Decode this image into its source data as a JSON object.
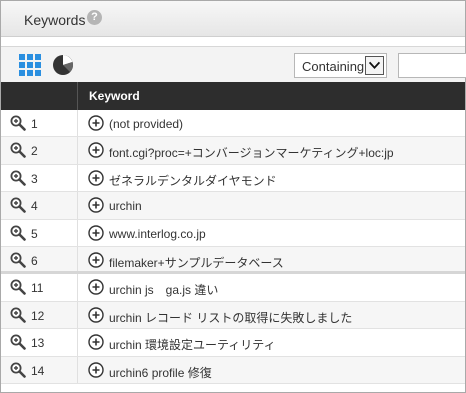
{
  "header": {
    "title": "Keywords",
    "help_icon": "?"
  },
  "toolbar": {
    "icons": [
      "grid-view-icon",
      "pie-chart-icon"
    ],
    "filter_mode": "Containing",
    "search_value": ""
  },
  "table": {
    "columns": [
      "",
      "Keyword"
    ],
    "rows": [
      {
        "index": "1",
        "keyword": "(not provided)"
      },
      {
        "index": "2",
        "keyword": "font.cgi?proc=+コンバージョンマーケティング+loc:jp"
      },
      {
        "index": "3",
        "keyword": "ゼネラルデンタルダイヤモンド"
      },
      {
        "index": "4",
        "keyword": "urchin"
      },
      {
        "index": "5",
        "keyword": "www.interlog.co.jp"
      },
      {
        "index": "6",
        "keyword": "filemaker+サンプルデータベース"
      },
      {
        "index": "11",
        "keyword": "urchin js　ga.js 違い"
      },
      {
        "index": "12",
        "keyword": "urchin レコード リストの取得に失敗しました"
      },
      {
        "index": "13",
        "keyword": "urchin 環境設定ユーティリティ"
      },
      {
        "index": "14",
        "keyword": "urchin6 profile 修復"
      }
    ]
  },
  "colors": {
    "header_bg": "#2d2d2d",
    "accent": "#2a8fe0"
  }
}
